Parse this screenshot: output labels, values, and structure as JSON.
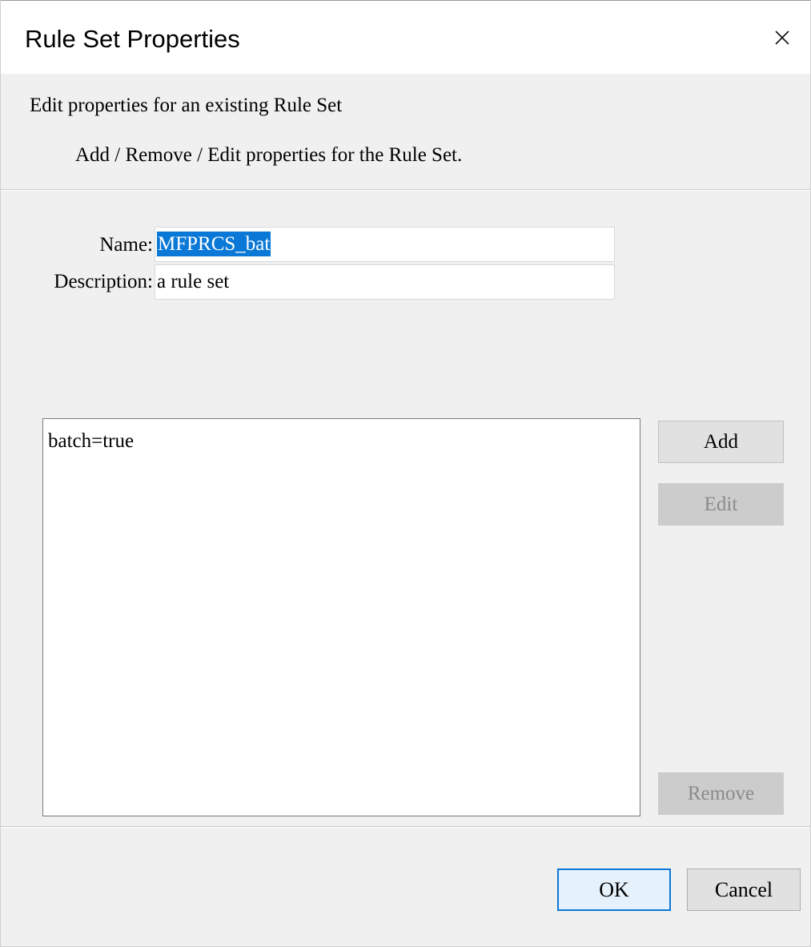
{
  "window": {
    "title": "Rule Set Properties",
    "close_icon": "close-icon"
  },
  "header": {
    "title": "Edit properties for an existing Rule Set",
    "subtitle": "Add / Remove / Edit properties for the Rule Set."
  },
  "form": {
    "name_label": "Name:",
    "name_value": "MFPRCS_bat",
    "description_label": "Description:",
    "description_value": "a rule set"
  },
  "properties": {
    "items": [
      "batch=true"
    ]
  },
  "side_buttons": {
    "add": "Add",
    "edit": "Edit",
    "remove": "Remove"
  },
  "footer": {
    "ok": "OK",
    "cancel": "Cancel"
  },
  "colors": {
    "selection": "#0a78d7",
    "dialog_bg": "#f0f0f0",
    "default_button_border": "#0a78d7"
  }
}
